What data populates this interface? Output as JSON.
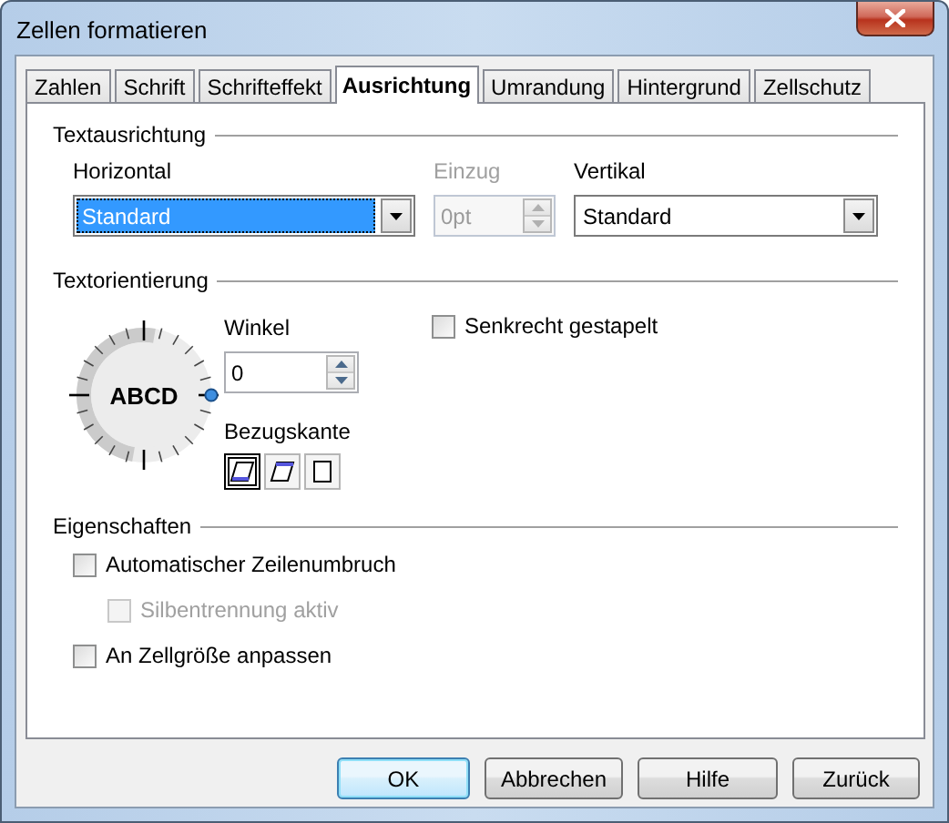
{
  "window": {
    "title": "Zellen formatieren"
  },
  "tabs": [
    {
      "label": "Zahlen",
      "selected": false
    },
    {
      "label": "Schrift",
      "selected": false
    },
    {
      "label": "Schrifteffekt",
      "selected": false
    },
    {
      "label": "Ausrichtung",
      "selected": true
    },
    {
      "label": "Umrandung",
      "selected": false
    },
    {
      "label": "Hintergrund",
      "selected": false
    },
    {
      "label": "Zellschutz",
      "selected": false
    }
  ],
  "text_alignment": {
    "title": "Textausrichtung",
    "horizontal": {
      "label": "Horizontal",
      "value": "Standard",
      "highlighted": true
    },
    "indent": {
      "label": "Einzug",
      "value": "0pt",
      "disabled": true
    },
    "vertical": {
      "label": "Vertikal",
      "value": "Standard",
      "highlighted": false
    }
  },
  "text_orientation": {
    "title": "Textorientierung",
    "dial_text": "ABCD",
    "angle": {
      "label": "Winkel",
      "value": "0"
    },
    "reference_edge": {
      "label": "Bezugskante",
      "options": [
        {
          "kind": "bottom",
          "selected": true
        },
        {
          "kind": "top",
          "selected": false
        },
        {
          "kind": "inside",
          "selected": false
        }
      ]
    },
    "stacked": {
      "label": "Senkrecht gestapelt",
      "checked": false,
      "disabled": false
    }
  },
  "properties": {
    "title": "Eigenschaften",
    "options": [
      {
        "label": "Automatischer Zeilenumbruch",
        "checked": false,
        "disabled": false,
        "children": [
          {
            "label": "Silbentrennung aktiv",
            "checked": false,
            "disabled": true
          }
        ]
      },
      {
        "label": "An Zellgröße anpassen",
        "checked": false,
        "disabled": false
      }
    ]
  },
  "buttons": [
    {
      "label": "OK",
      "default": true
    },
    {
      "label": "Abbrechen",
      "default": false
    },
    {
      "label": "Hilfe",
      "default": false
    },
    {
      "label": "Zurück",
      "default": false
    }
  ]
}
